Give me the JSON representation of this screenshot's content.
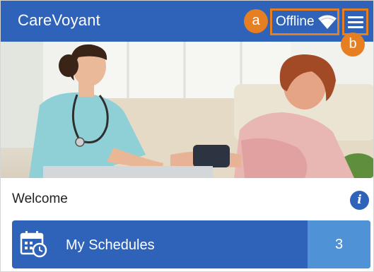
{
  "app": {
    "title": "CareVoyant"
  },
  "status": {
    "text": "Offline",
    "icon": "wifi-icon"
  },
  "menu": {
    "icon": "hamburger-menu-icon"
  },
  "callouts": {
    "a": "a",
    "b": "b"
  },
  "hero": {
    "description_icon": "nurse-patient-photo"
  },
  "welcome": {
    "label": "Welcome",
    "info_icon": "i"
  },
  "schedules": {
    "label": "My Schedules",
    "count": "3",
    "icon": "calendar-clock-icon"
  },
  "colors": {
    "primary": "#2f63b9",
    "count_bg": "#4f93d6",
    "callout": "#e67e22"
  }
}
